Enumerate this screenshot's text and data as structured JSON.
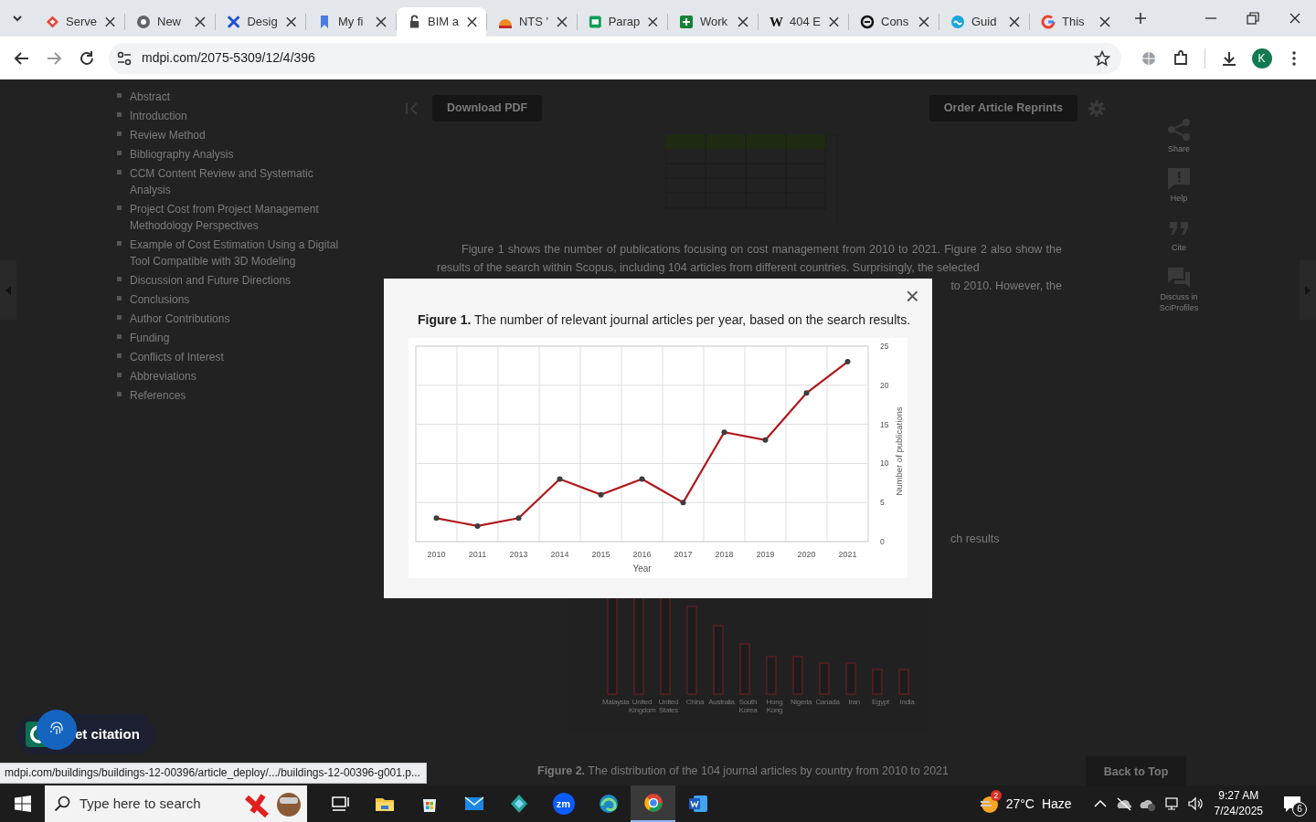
{
  "browser": {
    "tabs": [
      {
        "label": "Serve",
        "selected": false
      },
      {
        "label": "New",
        "selected": false
      },
      {
        "label": "Desig",
        "selected": false
      },
      {
        "label": "My fi",
        "selected": false
      },
      {
        "label": "BIM a",
        "selected": true
      },
      {
        "label": "NTS '",
        "selected": false
      },
      {
        "label": "Parap",
        "selected": false
      },
      {
        "label": "Work",
        "selected": false
      },
      {
        "label": "404 E",
        "selected": false,
        "favicon_text": "W"
      },
      {
        "label": "Cons",
        "selected": false
      },
      {
        "label": "Guid",
        "selected": false
      },
      {
        "label": "This",
        "selected": false
      }
    ],
    "address": "mdpi.com/2075-5309/12/4/396",
    "profile_initial": "K"
  },
  "toc": [
    "Abstract",
    "Introduction",
    "Review Method",
    "Bibliography Analysis",
    "CCM Content Review and Systematic Analysis",
    "Project Cost from Project Management Methodology Perspectives",
    "Example of Cost Estimation Using a Digital Tool Compatible with 3D Modeling",
    "Discussion and Future Directions",
    "Conclusions",
    "Author Contributions",
    "Funding",
    "Conflicts of Interest",
    "Abbreviations",
    "References"
  ],
  "toolbar": {
    "download": "Download PDF",
    "reprints": "Order Article Reprints"
  },
  "article": {
    "paragraph": "Figure 1 shows the number of publications focusing on cost management from 2010 to 2021. Figure 2 also show the results of the search within Scopus, including 104 articles from different countries. Surprisingly, the selected",
    "paragraph_tail": "to 2010. However, the",
    "partial_text": "ch results"
  },
  "figure_2": {
    "countries": [
      "Malaysia",
      "United Kingdom",
      "United States",
      "China",
      "Australia",
      "South Korea",
      "Hong Kong",
      "Nigeria",
      "Canada",
      "Iran",
      "Egypt",
      "India"
    ],
    "caption": "**Figure 2.** The distribution of the 104 journal articles by country from 2010 to 2021"
  },
  "back_to_top": "Back to Top",
  "side_tools": [
    "Share",
    "Help",
    "Cite",
    "Discuss in SciProfiles"
  ],
  "modal": {
    "close": "×",
    "caption": "**Figure 1.** The number of relevant journal articles per year, based on the search results.",
    "chart_data": {
      "type": "line",
      "xlabel": "Year",
      "ylabel": "Number of publications",
      "categories": [
        "2010",
        "2011",
        "2013",
        "2014",
        "2015",
        "2016",
        "2017",
        "2018",
        "2019",
        "2020",
        "2021"
      ],
      "grid": true,
      "series": [
        {
          "color": "#b0181c",
          "marker": "circle",
          "values": [
            3,
            2,
            3,
            8,
            6,
            8,
            5,
            14,
            13,
            19,
            23
          ]
        }
      ],
      "ylim": [
        0,
        25
      ],
      "yticks": [
        0,
        5,
        10,
        15,
        20,
        25
      ]
    }
  },
  "citation_button": "et citation",
  "status_url": "mdpi.com/buildings/buildings-12-00396/article_deploy/.../buildings-12-00396-g001.p...",
  "taskbar": {
    "search_placeholder": "Type here to search",
    "apps": [
      {
        "selected": false
      },
      {
        "selected": false
      },
      {
        "selected": false
      },
      {
        "selected": false
      },
      {
        "selected": false
      },
      {
        "selected": false,
        "label": "zm"
      },
      {
        "selected": false
      },
      {
        "selected": true
      },
      {
        "selected": false
      }
    ],
    "tray": {
      "weather_badge": "2",
      "temperature": "27°C",
      "condition": "Haze",
      "time": "9:27 AM",
      "date": "7/24/2025",
      "notifications": "6"
    }
  }
}
